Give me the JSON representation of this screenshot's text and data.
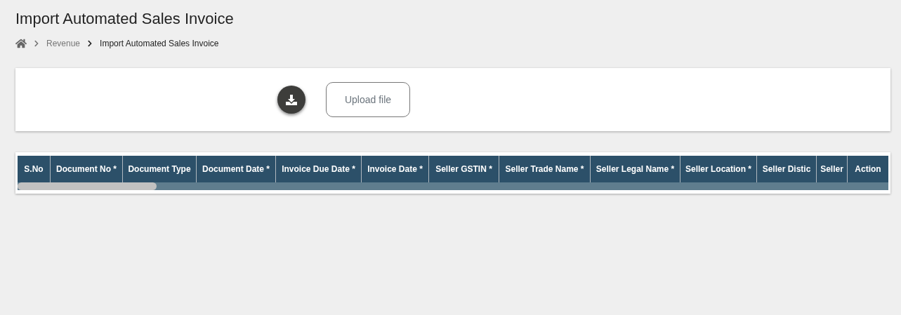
{
  "page_title": "Import Automated Sales Invoice",
  "breadcrumb": [
    {
      "label": "Revenue",
      "current": false
    },
    {
      "label": "Import Automated Sales Invoice",
      "current": true
    }
  ],
  "upload_button": "Upload file",
  "table": {
    "columns": [
      "S.No",
      "Document No *",
      "Document Type",
      "Document Date *",
      "Invoice Due Date *",
      "Invoice Date *",
      "Seller GSTIN *",
      "Seller Trade Name *",
      "Seller Legal Name *",
      "Seller Location *",
      "Seller Distic",
      "Seller"
    ],
    "action_column": "Action"
  }
}
